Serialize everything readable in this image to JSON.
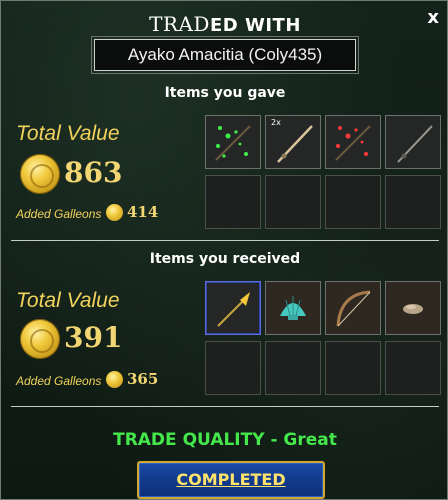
{
  "header": {
    "title_prefix": "TRAD",
    "title_suffix": "ED WITH",
    "close_label": "x",
    "partner_name": "Ayako Amacitia (Coly435)"
  },
  "gave": {
    "heading": "Items you gave",
    "total_label": "Total Value",
    "total_value": "863",
    "galleons_label": "Added Galleons",
    "galleons_value": "414",
    "items": [
      {
        "icon": "green-sparkle-staff-icon",
        "qty": ""
      },
      {
        "icon": "fishing-rod-icon",
        "qty": "2x"
      },
      {
        "icon": "red-sparkle-staff-icon",
        "qty": ""
      },
      {
        "icon": "dark-rod-icon",
        "qty": ""
      }
    ]
  },
  "received": {
    "heading": "Items you  received",
    "total_label": "Total Value",
    "total_value": "391",
    "galleons_label": "Added Galleons",
    "galleons_value": "365",
    "items": [
      {
        "icon": "golden-spear-icon",
        "qty": ""
      },
      {
        "icon": "seashell-icon",
        "qty": ""
      },
      {
        "icon": "bow-icon",
        "qty": ""
      },
      {
        "icon": "stone-icon",
        "qty": ""
      }
    ]
  },
  "footer": {
    "quality": "TRADE QUALITY - Great",
    "button": "COMPLETED"
  },
  "colors": {
    "gold_text": "#f1d25b",
    "quality_green": "#45e84a",
    "button_blue": "#123a8c",
    "button_text": "#ffe36b"
  }
}
